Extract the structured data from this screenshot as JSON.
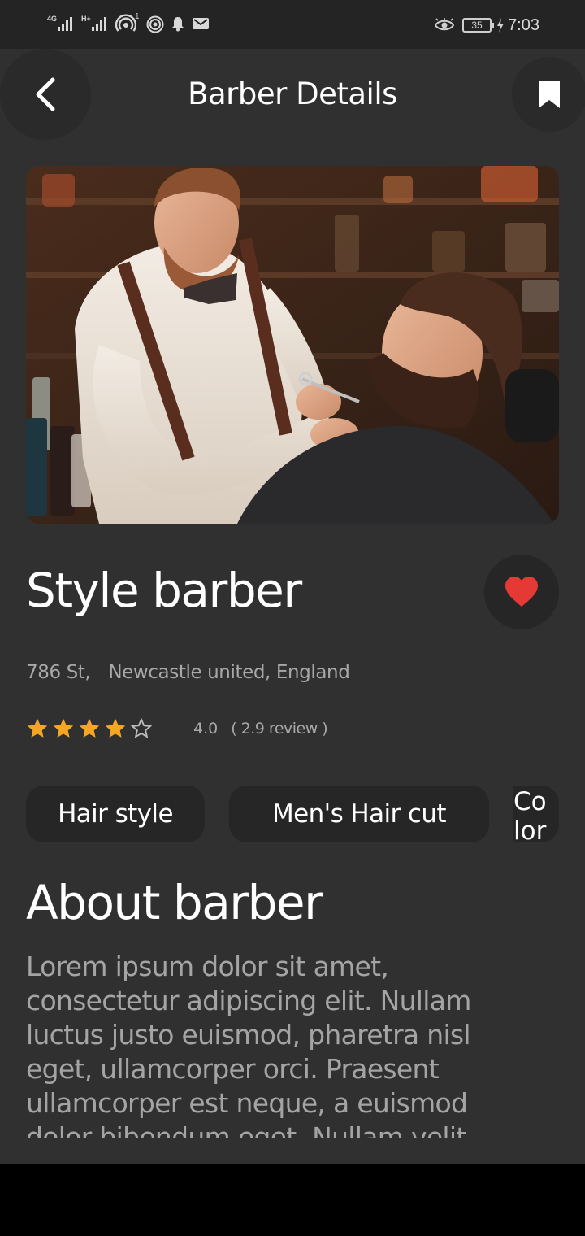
{
  "status_bar": {
    "network_1": "4G",
    "network_2": "H+",
    "notification_count": "1",
    "battery": "35",
    "time": "7:03"
  },
  "header": {
    "title": "Barber Details"
  },
  "barber": {
    "name": "Style barber",
    "address_street": "786 St,",
    "address_city": "Newcastle united, England",
    "rating": 4,
    "rating_text": "4.0",
    "reviews_text": "( 2.9 review )"
  },
  "services": [
    "Hair style",
    "Men's Hair cut",
    "Colori"
  ],
  "about": {
    "title": "About barber",
    "text": "Lorem ipsum dolor sit amet, consectetur adipiscing elit. Nullam luctus justo euismod, pharetra nisl eget, ullamcorper orci. Praesent ullamcorper est neque, a euismod dolor bibendum eget. Nullam velit"
  },
  "colors": {
    "background": "#303030",
    "surface": "#262626",
    "accent_star": "#f5a623",
    "heart": "#e53935",
    "secondary_text": "#a8a8a8"
  },
  "icons": [
    "back-arrow-icon",
    "bookmark-icon",
    "heart-icon",
    "star-icon",
    "eye-icon",
    "bell-icon",
    "mail-icon"
  ]
}
